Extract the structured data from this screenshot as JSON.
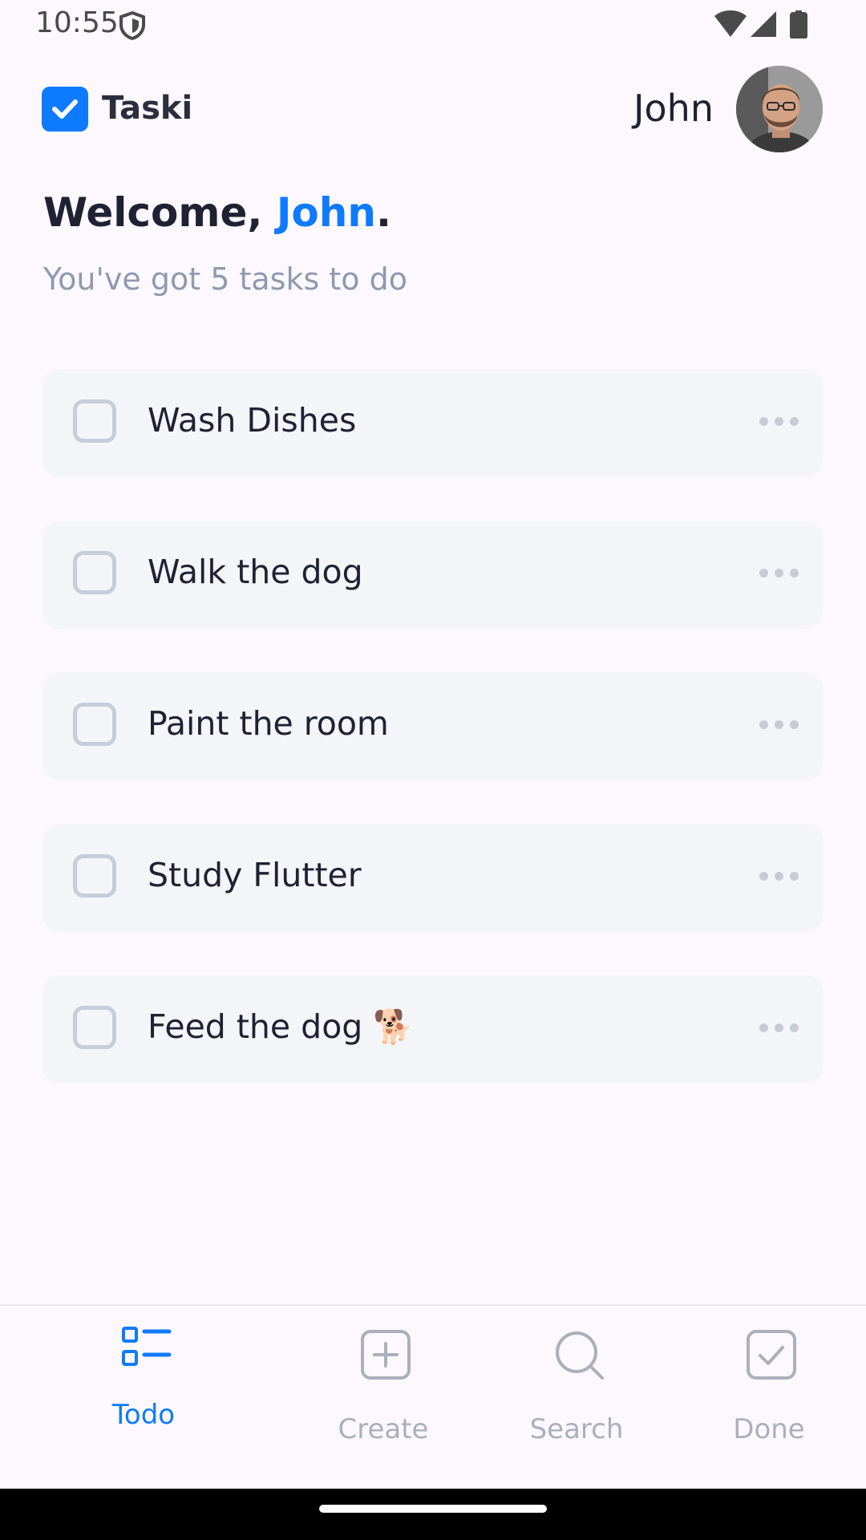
{
  "status_bar": {
    "time": "10:55",
    "icons": [
      "shield-icon",
      "wifi-icon",
      "signal-icon",
      "battery-icon"
    ]
  },
  "header": {
    "app_name": "Taski",
    "user_name": "John",
    "brand_color": "#0E7AFE"
  },
  "welcome": {
    "greeting": "Welcome, ",
    "name": "John",
    "punctuation": ".",
    "subtitle": "You've got 5 tasks to do"
  },
  "tasks": [
    {
      "title": "Wash Dishes",
      "done": false
    },
    {
      "title": "Walk the dog",
      "done": false
    },
    {
      "title": "Paint the room",
      "done": false
    },
    {
      "title": "Study Flutter",
      "done": false
    },
    {
      "title": "Feed the dog 🐕",
      "done": false
    }
  ],
  "bottom_nav": {
    "items": [
      {
        "label": "Todo",
        "icon": "todo-list-icon",
        "active": true
      },
      {
        "label": "Create",
        "icon": "plus-square-icon",
        "active": false
      },
      {
        "label": "Search",
        "icon": "search-icon",
        "active": false
      },
      {
        "label": "Done",
        "icon": "check-square-icon",
        "active": false
      }
    ]
  }
}
